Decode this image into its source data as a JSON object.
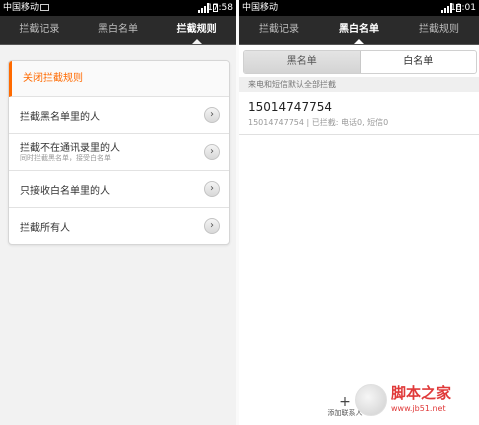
{
  "left": {
    "status": {
      "carrier": "中国移动",
      "time": "17:58"
    },
    "tabs": [
      {
        "label": "拦截记录"
      },
      {
        "label": "黑白名单"
      },
      {
        "label": "拦截规则"
      }
    ],
    "rules": {
      "header": "关闭拦截规则",
      "items": [
        {
          "label": "拦截黑名单里的人",
          "sub": ""
        },
        {
          "label": "拦截不在通讯录里的人",
          "sub": "同时拦截黑名单，接受白名单"
        },
        {
          "label": "只接收白名单里的人",
          "sub": ""
        },
        {
          "label": "拦截所有人",
          "sub": ""
        }
      ],
      "chevron": "›"
    }
  },
  "right": {
    "status": {
      "carrier": "中国移动",
      "time": "18:01"
    },
    "tabs": [
      {
        "label": "拦截记录"
      },
      {
        "label": "黑白名单"
      },
      {
        "label": "拦截规则"
      }
    ],
    "segments": [
      {
        "label": "黑名单"
      },
      {
        "label": "白名单"
      }
    ],
    "hint": "来电和短信默认全部拦截",
    "entry": {
      "number": "15014747754",
      "meta": "15014747754 | 已拦截: 电话0, 短信0"
    },
    "add_contact": {
      "plus": "+",
      "label": "添加联系人"
    }
  },
  "watermark": {
    "title": "脚本之家",
    "url": "www.jb51.net"
  },
  "colors": {
    "accent": "#ff6a00",
    "tabbar": "#2b2b2b",
    "watermark": "#e03a3a"
  }
}
